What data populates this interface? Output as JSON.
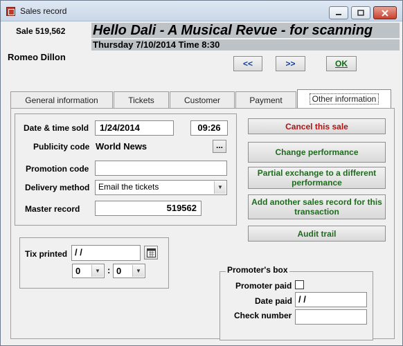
{
  "window": {
    "title": "Sales record"
  },
  "header": {
    "sale_number": "Sale 519,562",
    "show_title": "Hello Dali - A Musical Revue - for scanning",
    "performance_datetime": "Thursday 7/10/2014  Time 8:30",
    "customer_name": "Romeo Dillon"
  },
  "nav": {
    "prev_label": "<<",
    "next_label": ">>",
    "ok_label": "OK"
  },
  "tabs": [
    {
      "label": "General information",
      "active": false
    },
    {
      "label": "Tickets",
      "active": false
    },
    {
      "label": "Customer",
      "active": false
    },
    {
      "label": "Payment",
      "active": false
    },
    {
      "label": "Other information",
      "active": true
    }
  ],
  "form": {
    "date_time_sold_label": "Date & time sold",
    "date_sold_value": "1/24/2014",
    "time_sold_value": "09:26",
    "publicity_code_label": "Publicity code",
    "publicity_code_value": "World News",
    "publicity_lookup_label": "...",
    "promotion_code_label": "Promotion code",
    "promotion_code_value": "",
    "delivery_method_label": "Delivery method",
    "delivery_method_value": "Email the tickets",
    "master_record_label": "Master record",
    "master_record_value": "519562"
  },
  "actions": {
    "cancel_sale": "Cancel this sale",
    "change_performance": "Change performance",
    "partial_exchange": "Partial exchange to a different performance",
    "add_sales_record": "Add another sales record for this transaction",
    "audit_trail": "Audit trail"
  },
  "tix_printed": {
    "label": "Tix printed",
    "date_value": "  /  /",
    "hour_value": "0",
    "minute_value": "0",
    "time_separator": ":"
  },
  "promoter_box": {
    "legend": "Promoter's box",
    "promoter_paid_label": "Promoter paid",
    "promoter_paid_checked": false,
    "date_paid_label": "Date paid",
    "date_paid_value": "  /  /",
    "check_number_label": "Check number",
    "check_number_value": ""
  },
  "colors": {
    "title_band": "#bdc2c7",
    "cancel_text": "#b01212",
    "action_text": "#1f6a1f",
    "nav_text": "#123f9c"
  }
}
